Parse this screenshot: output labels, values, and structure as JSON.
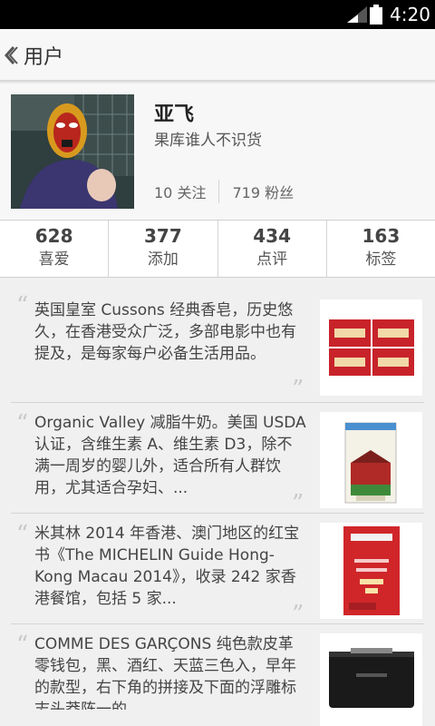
{
  "status_bar": {
    "time": "4:20"
  },
  "header": {
    "title": "用户"
  },
  "profile": {
    "name": "亚飞",
    "bio": "果库谁人不识货",
    "following": "10 关注",
    "followers": "719 粉丝"
  },
  "stats": [
    {
      "value": "628",
      "label": "喜爱"
    },
    {
      "value": "377",
      "label": "添加"
    },
    {
      "value": "434",
      "label": "点评"
    },
    {
      "value": "163",
      "label": "标签"
    }
  ],
  "feed": [
    {
      "text": "英国皇室 Cussons 经典香皂，历史悠久，在香港受众广泛，多部电影中也有提及，是每家每户必备生活用品。"
    },
    {
      "text": "Organic Valley 减脂牛奶。美国 USDA 认证，含维生素 A、维生素 D3，除不满一周岁的婴儿外，适合所有人群饮用，尤其适合孕妇、..."
    },
    {
      "text": "米其林 2014 年香港、澳门地区的红宝书《The MICHELIN Guide Hong-Kong Macau 2014》，收录 242 家香港餐馆，包括 5 家..."
    },
    {
      "text": "COMME DES GARÇONS 纯色款皮革零钱包，黑、酒红、天蓝三色入，早年的款型，右下角的拼接及下面的浮雕标志头莽阵一的"
    }
  ],
  "colors": {
    "status_bar": "#000000",
    "background": "#f0f0f0",
    "accent_red": "#d0262a"
  },
  "icons": {
    "back": "chevron-left-icon",
    "signal": "signal-icon",
    "battery": "battery-icon",
    "quote_open": "quote-open-icon",
    "quote_close": "quote-close-icon"
  }
}
